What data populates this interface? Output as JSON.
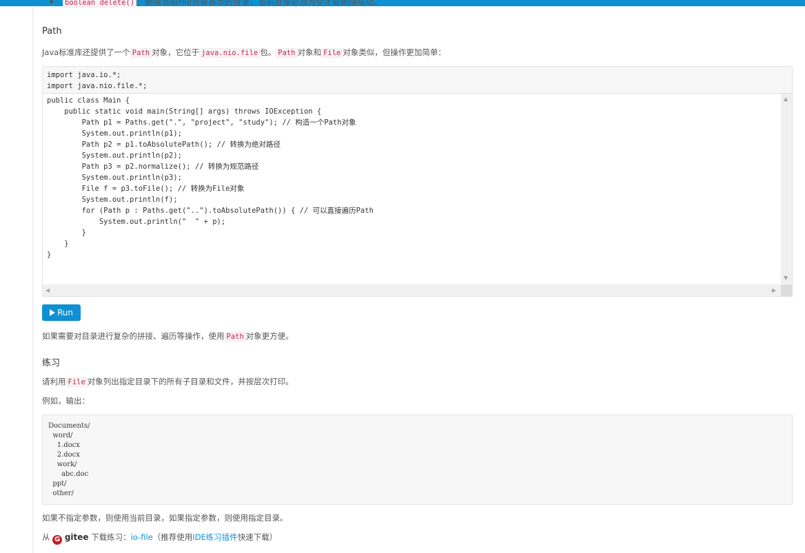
{
  "prev_item": {
    "code": "boolean delete()",
    "text": "：删除当前File对象表示的目录，当前目录必须为空才能删除成功。"
  },
  "path_section": {
    "heading": "Path",
    "intro_1": "Java标准库还提供了一个",
    "intro_code_1": "Path",
    "intro_2": "对象，它位于",
    "intro_code_2": "java.nio.file",
    "intro_3": "包。",
    "intro_code_3": "Path",
    "intro_4": "对象和",
    "intro_code_4": "File",
    "intro_5": "对象类似，但操作更加简单：",
    "imports": "import java.io.*;\nimport java.nio.file.*;",
    "editor_code": "public class Main {\n    public static void main(String[] args) throws IOException {\n        Path p1 = Paths.get(\".\", \"project\", \"study\"); // 构造一个Path对象\n        System.out.println(p1);\n        Path p2 = p1.toAbsolutePath(); // 转换为绝对路径\n        System.out.println(p2);\n        Path p3 = p2.normalize(); // 转换为规范路径\n        System.out.println(p3);\n        File f = p3.toFile(); // 转换为File对象\n        System.out.println(f);\n        for (Path p : Paths.get(\"..\").toAbsolutePath()) { // 可以直接遍历Path\n            System.out.println(\"  \" + p);\n        }\n    }\n}",
    "run_label": "Run",
    "after_1": "如果需要对目录进行复杂的拼接、遍历等操作，使用",
    "after_code": "Path",
    "after_2": "对象更方便。"
  },
  "exercise": {
    "heading": "练习",
    "task_1": "请利用",
    "task_code": "File",
    "task_2": "对象列出指定目录下的所有子目录和文件，并按层次打印。",
    "example_label": "例如，输出：",
    "output": "Documents/\n  word/\n    1.docx\n    2.docx\n    work/\n      abc.doc\n  ppt/\n  other/",
    "note": "如果不指定参数，则使用当前目录，如果指定参数，则使用指定目录。",
    "download_1": "从",
    "gitee_logo_letter": "G",
    "gitee_word": "gitee",
    "download_2": "下载练习：",
    "download_link": "io-file",
    "download_3": "（推荐使用",
    "plugin_link": "IDE练习插件",
    "download_4": "快速下载）"
  },
  "colors": {
    "accent": "#0e90d2",
    "inline_code": "#c7254e",
    "gitee": "#c71d23"
  }
}
